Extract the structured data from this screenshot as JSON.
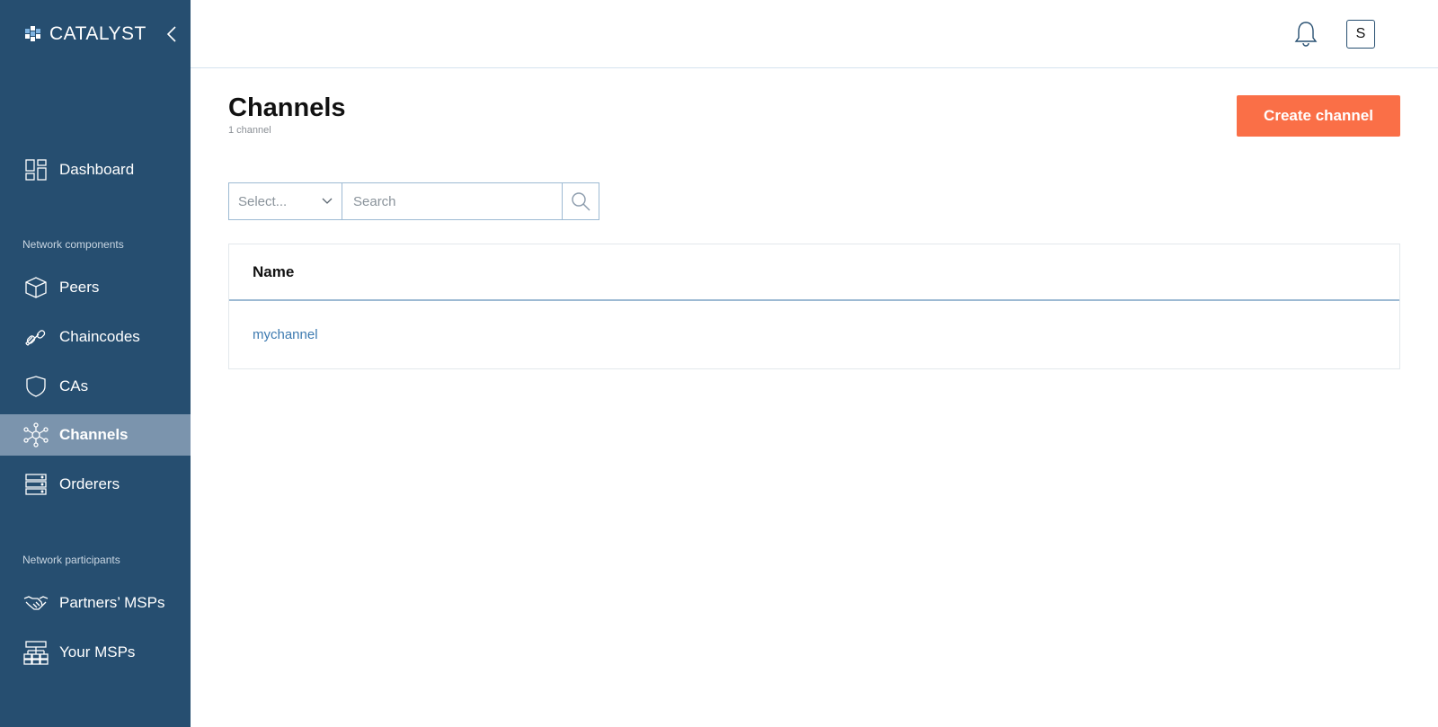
{
  "app": {
    "brand": "CATALYST"
  },
  "colors": {
    "sidebar": "#264e70",
    "active_item": "#7b94ad",
    "accent": "#fa6f47",
    "link": "#3d7ab0"
  },
  "sidebar": {
    "dashboard": {
      "label": "Dashboard",
      "icon": "dashboard-icon"
    },
    "section_components": "Network components",
    "components": [
      {
        "label": "Peers",
        "icon": "cube-icon"
      },
      {
        "label": "Chaincodes",
        "icon": "link-icon"
      },
      {
        "label": "CAs",
        "icon": "shield-icon"
      },
      {
        "label": "Channels",
        "icon": "network-icon",
        "active": true
      },
      {
        "label": "Orderers",
        "icon": "server-icon"
      }
    ],
    "section_participants": "Network participants",
    "participants": [
      {
        "label": "Partners’ MSPs",
        "icon": "handshake-icon"
      },
      {
        "label": "Your MSPs",
        "icon": "hierarchy-icon"
      }
    ]
  },
  "header": {
    "avatar_initial": "S"
  },
  "main": {
    "title": "Channels",
    "subtitle": "1 channel",
    "create_button": "Create channel",
    "filter": {
      "select_placeholder": "Select...",
      "search_placeholder": "Search"
    },
    "table": {
      "column": "Name",
      "rows": [
        "mychannel"
      ]
    }
  }
}
